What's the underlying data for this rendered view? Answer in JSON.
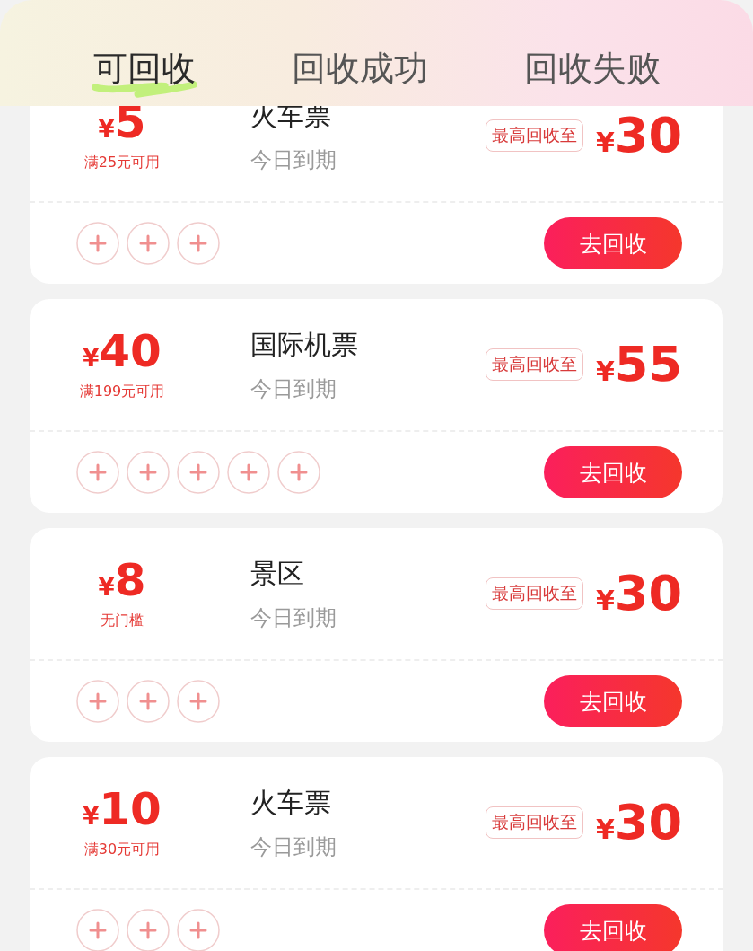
{
  "tabs": [
    {
      "label": "可回收",
      "selected": true
    },
    {
      "label": "回收成功",
      "selected": false
    },
    {
      "label": "回收失败",
      "selected": false
    }
  ],
  "coupons": [
    {
      "currency": "¥",
      "amount": "5",
      "condition": "满25元可用",
      "title": "火车票",
      "expiry": "今日到期",
      "badge": "最高回收至",
      "max_currency": "¥",
      "max_amount": "30",
      "slots": [
        {
          "kind": "add"
        },
        {
          "kind": "add"
        },
        {
          "kind": "add"
        }
      ],
      "button": "去回收"
    },
    {
      "currency": "¥",
      "amount": "40",
      "condition": "满199元可用",
      "title": "国际机票",
      "expiry": "今日到期",
      "badge": "最高回收至",
      "max_currency": "¥",
      "max_amount": "55",
      "slots": [
        {
          "kind": "add"
        },
        {
          "kind": "add"
        },
        {
          "kind": "add"
        },
        {
          "kind": "add"
        },
        {
          "kind": "add"
        }
      ],
      "button": "去回收"
    },
    {
      "currency": "¥",
      "amount": "8",
      "condition": "无门槛",
      "title": "景区",
      "expiry": "今日到期",
      "badge": "最高回收至",
      "max_currency": "¥",
      "max_amount": "30",
      "slots": [
        {
          "kind": "add"
        },
        {
          "kind": "add"
        },
        {
          "kind": "add"
        }
      ],
      "button": "去回收"
    },
    {
      "currency": "¥",
      "amount": "10",
      "condition": "满30元可用",
      "title": "火车票",
      "expiry": "今日到期",
      "badge": "最高回收至",
      "max_currency": "¥",
      "max_amount": "30",
      "slots": [
        {
          "kind": "add"
        },
        {
          "kind": "add"
        },
        {
          "kind": "add"
        }
      ],
      "button": "去回收"
    }
  ]
}
